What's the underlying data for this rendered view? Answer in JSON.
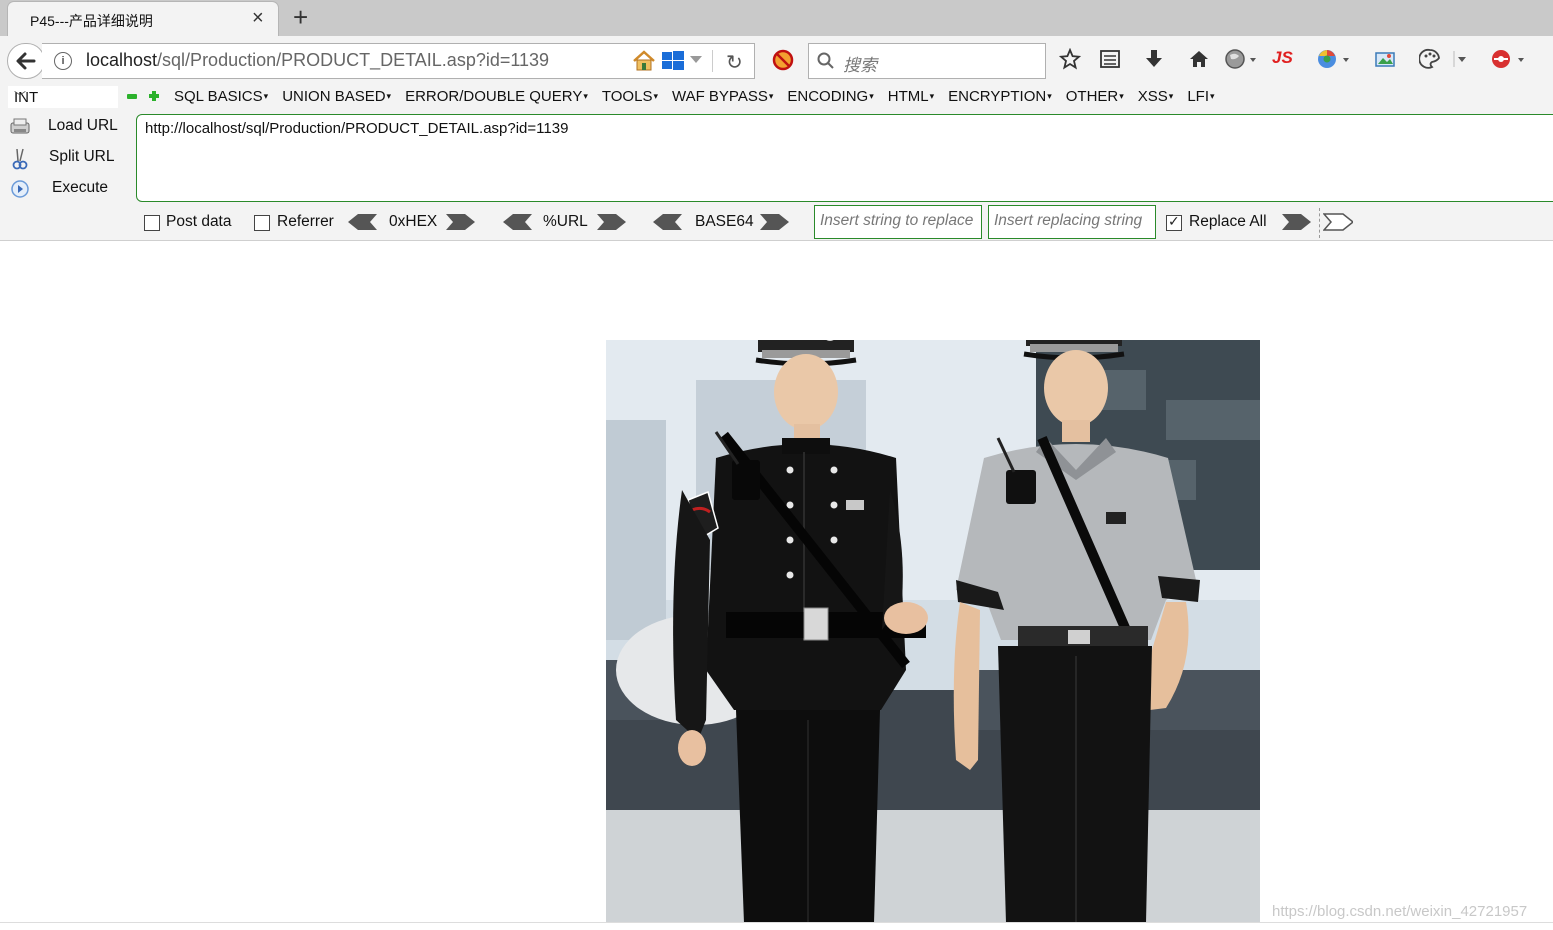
{
  "tab": {
    "title": "P45---产品详细说明",
    "close_glyph": "×",
    "new_tab_glyph": "+"
  },
  "navbar": {
    "url_host": "localhost",
    "url_path": "/sql/Production/PRODUCT_DETAIL.asp?id=1139",
    "search_placeholder": "搜索",
    "js_badge": "JS"
  },
  "hackbar": {
    "type_select": "INT",
    "menu": [
      "SQL BASICS",
      "UNION BASED",
      "ERROR/DOUBLE QUERY",
      "TOOLS",
      "WAF BYPASS",
      "ENCODING",
      "HTML",
      "ENCRYPTION",
      "OTHER",
      "XSS",
      "LFI"
    ],
    "load_url": "Load URL",
    "split_url": "Split URL",
    "execute": "Execute",
    "url_value": "http://localhost/sql/Production/PRODUCT_DETAIL.asp?id=1139",
    "post_data": "Post data",
    "referrer": "Referrer",
    "hex": "0xHEX",
    "url_enc": "%URL",
    "base64": "BASE64",
    "replace_from_placeholder": "Insert string to replace",
    "replace_to_placeholder": "Insert replacing string",
    "replace_all": "Replace All",
    "post_data_checked": false,
    "referrer_checked": false,
    "replace_all_checked": true
  },
  "page": {
    "watermark": "https://blog.csdn.net/weixin_42721957"
  },
  "colors": {
    "hackbar_green": "#2a8a2a",
    "tab_strip": "#c9c9c9",
    "toolbar_bg": "#f3f3f3"
  }
}
